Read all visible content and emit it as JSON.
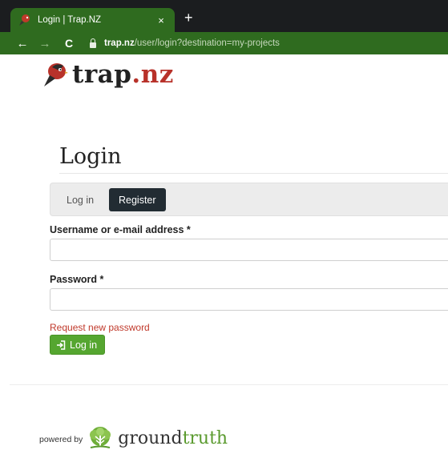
{
  "browser": {
    "tab": {
      "title": "Login | Trap.NZ",
      "close_glyph": "×",
      "favicon": "trap-nz-bird-icon"
    },
    "new_tab_glyph": "+",
    "nav": {
      "back_glyph": "←",
      "forward_glyph": "→",
      "reload_glyph": "C"
    },
    "address": {
      "host": "trap.nz",
      "path": "/user/login?destination=my-projects"
    },
    "colors": {
      "chrome_dark": "#1b1d1f",
      "chrome_green": "#2f6b1f"
    }
  },
  "header": {
    "logo_part1": "trap",
    "logo_part2": ".nz",
    "logo_color_accent": "#b8322a"
  },
  "main": {
    "title": "Login",
    "tabs": [
      {
        "label": "Log in",
        "active": false
      },
      {
        "label": "Register",
        "active": true
      }
    ],
    "form": {
      "username_label": "Username or e-mail address *",
      "username_value": "",
      "password_label": "Password *",
      "password_value": "",
      "reset_link": "Request new password",
      "submit_label": "Log in"
    },
    "colors": {
      "button_green": "#55a630",
      "link_red": "#c0392b",
      "register_bg": "#222c33"
    }
  },
  "footer": {
    "powered_by": "powered by",
    "brand_part1": "ground",
    "brand_part2": "truth",
    "brand_color": "#5a9a2e"
  }
}
